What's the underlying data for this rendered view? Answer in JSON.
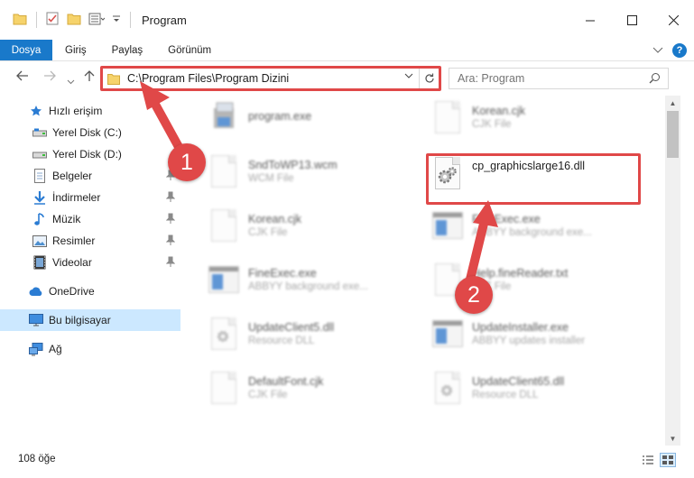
{
  "window": {
    "title": "Program",
    "controls": {
      "minimize": "—",
      "maximize": "☐",
      "close": "✕"
    }
  },
  "ribbon": {
    "tabs": [
      "Dosya",
      "Giriş",
      "Paylaş",
      "Görünüm"
    ],
    "help": "?"
  },
  "address": {
    "path": "C:\\Program Files\\Program Dizini"
  },
  "search": {
    "placeholder": "Ara: Program"
  },
  "sidebar": {
    "items": [
      {
        "label": "Hızlı erişim",
        "icon": "star-icon"
      },
      {
        "label": "Yerel Disk (C:)",
        "icon": "drive-icon"
      },
      {
        "label": "Yerel Disk (D:)",
        "icon": "drive-icon"
      },
      {
        "label": "Belgeler",
        "icon": "documents-icon",
        "pinned": true
      },
      {
        "label": "İndirmeler",
        "icon": "download-icon",
        "pinned": true
      },
      {
        "label": "Müzik",
        "icon": "music-icon",
        "pinned": true
      },
      {
        "label": "Resimler",
        "icon": "pictures-icon",
        "pinned": true
      },
      {
        "label": "Videolar",
        "icon": "videos-icon",
        "pinned": true
      },
      {
        "label": "OneDrive",
        "icon": "cloud-icon"
      },
      {
        "label": "Bu bilgisayar",
        "icon": "computer-icon",
        "selected": true
      },
      {
        "label": "Ağ",
        "icon": "network-icon"
      }
    ]
  },
  "files": [
    {
      "name": "program.exe",
      "type": "",
      "icon": "installer-icon"
    },
    {
      "name": "Korean.cjk",
      "type": "CJK File",
      "icon": "file-icon"
    },
    {
      "name": "SndToWP13.wcm",
      "type": "WCM File",
      "icon": "file-icon"
    },
    {
      "name": "cp_graphicslarge16.dll",
      "type": "",
      "icon": "dll-gear-icon",
      "highlighted": true
    },
    {
      "name": "Korean.cjk",
      "type": "CJK File",
      "icon": "file-icon"
    },
    {
      "name": "FineExec.exe",
      "type": "ABBYY background exe...",
      "icon": "app-icon"
    },
    {
      "name": "FineExec.exe",
      "type": "ABBYY background exe...",
      "icon": "app-icon"
    },
    {
      "name": "Help.fineReader.txt",
      "type": "TXT File",
      "icon": "file-icon"
    },
    {
      "name": "UpdateClient5.dll",
      "type": "Resource DLL",
      "icon": "dll-gear-icon"
    },
    {
      "name": "UpdateInstaller.exe",
      "type": "ABBYY updates installer",
      "icon": "app-icon"
    },
    {
      "name": "DefaultFont.cjk",
      "type": "CJK File",
      "icon": "file-icon"
    },
    {
      "name": "UpdateClient65.dll",
      "type": "Resource DLL",
      "icon": "dll-gear-icon"
    }
  ],
  "callouts": [
    "1",
    "2"
  ],
  "status": {
    "item_count": "108 öğe"
  },
  "colors": {
    "accent": "#1979ca",
    "callout": "#e04848",
    "selection": "#cce8ff"
  }
}
